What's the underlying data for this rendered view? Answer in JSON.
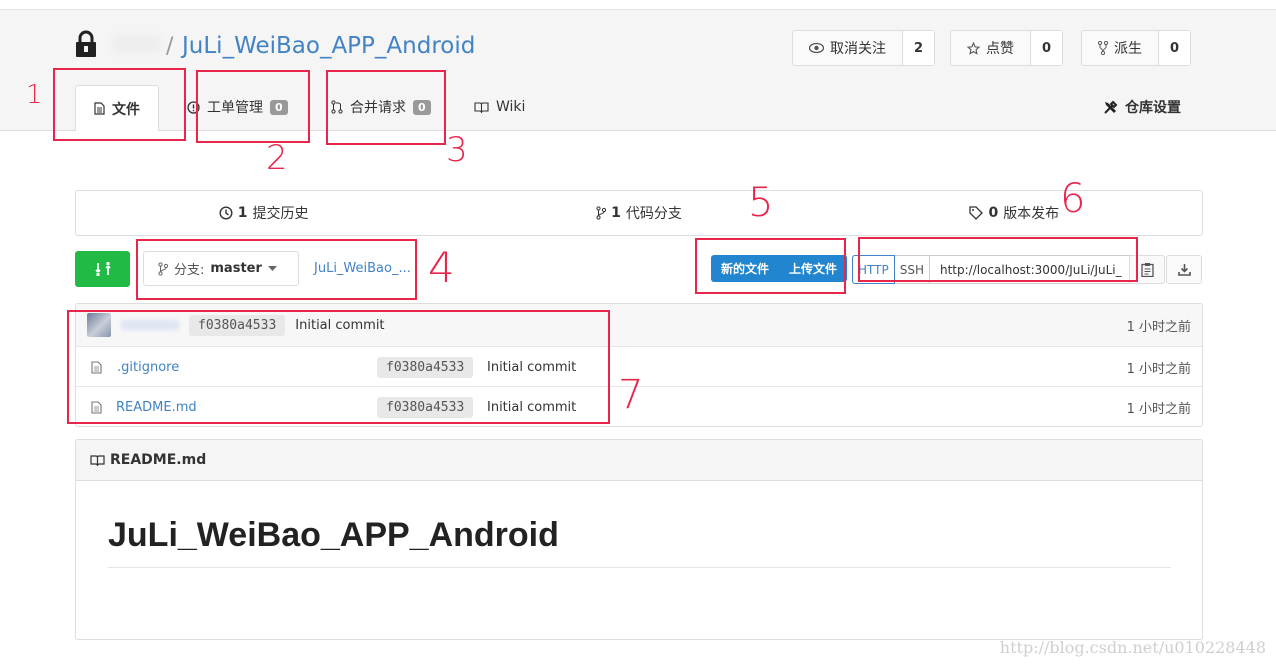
{
  "repo": {
    "name": "JuLi_WeiBao_APP_Android",
    "slash": "/"
  },
  "actions": {
    "unwatch": {
      "label": "取消关注",
      "count": "2",
      "icon": "eye-icon"
    },
    "star": {
      "label": "点赞",
      "count": "0",
      "icon": "star-icon"
    },
    "fork": {
      "label": "派生",
      "count": "0",
      "icon": "fork-icon"
    }
  },
  "tabs": {
    "files": "文件",
    "issues": {
      "label": "工单管理",
      "count": "0"
    },
    "pulls": {
      "label": "合并请求",
      "count": "0"
    },
    "wiki": "Wiki",
    "settings": "仓库设置"
  },
  "stats": {
    "commits": {
      "count": "1",
      "label": "提交历史"
    },
    "branches": {
      "count": "1",
      "label": "代码分支"
    },
    "releases": {
      "count": "0",
      "label": "版本发布"
    }
  },
  "branch": {
    "prefix": "分支:",
    "name": "master"
  },
  "breadcrumb": "JuLi_WeiBao_...",
  "upload": {
    "new_file": "新的文件",
    "upload_file": "上传文件"
  },
  "clone": {
    "http": "HTTP",
    "ssh": "SSH",
    "url": "http://localhost:3000/JuLi/JuLi_"
  },
  "latest_commit": {
    "sha": "f0380a4533",
    "message": "Initial commit",
    "age": "1 小时之前"
  },
  "files": [
    {
      "name": ".gitignore",
      "sha": "f0380a4533",
      "message": "Initial commit",
      "age": "1 小时之前"
    },
    {
      "name": "README.md",
      "sha": "f0380a4533",
      "message": "Initial commit",
      "age": "1 小时之前"
    }
  ],
  "readme": {
    "filename": "README.md",
    "title": "JuLi_WeiBao_APP_Android"
  },
  "annotations": [
    "1",
    "2",
    "3",
    "4",
    "5",
    "6",
    "7"
  ],
  "watermark": "http://blog.csdn.net/u010228448",
  "colors": {
    "link": "#4183c4",
    "primary": "#2185d0",
    "green": "#21ba45",
    "annotation": "#e8254b"
  }
}
